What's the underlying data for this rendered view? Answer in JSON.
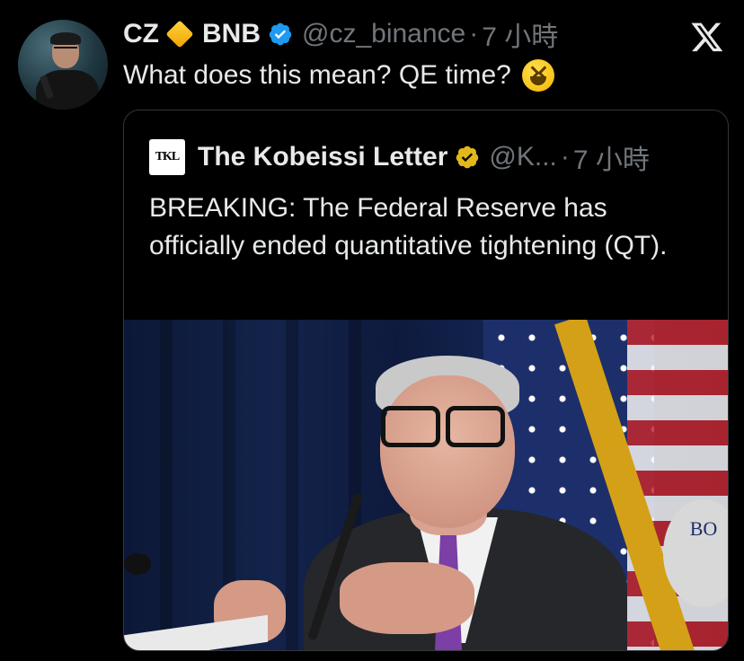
{
  "tweet": {
    "author_name": "CZ",
    "author_suffix": "BNB",
    "handle": "@cz_binance",
    "separator": "·",
    "time": "7 小時",
    "text": "What does this mean? QE time?"
  },
  "quoted": {
    "logo_text": "TKL",
    "author_name": "The Kobeissi Letter",
    "handle": "@K...",
    "separator": "·",
    "time": "7 小時",
    "text": "BREAKING: The Federal Reserve has officially ended quantitative tightening (QT).",
    "image_seal_text": "BO"
  },
  "colors": {
    "background": "#000000",
    "text": "#e7e9ea",
    "muted": "#71767b",
    "verified_blue": "#1d9bf0",
    "verified_gold": "#e2b719",
    "border": "#333639"
  },
  "icons": {
    "close": "close-icon",
    "verified": "verified-badge-icon",
    "gold_verified": "gold-verified-badge-icon",
    "diamond": "diamond-emoji-icon",
    "laughing": "laughing-emoji-icon"
  }
}
